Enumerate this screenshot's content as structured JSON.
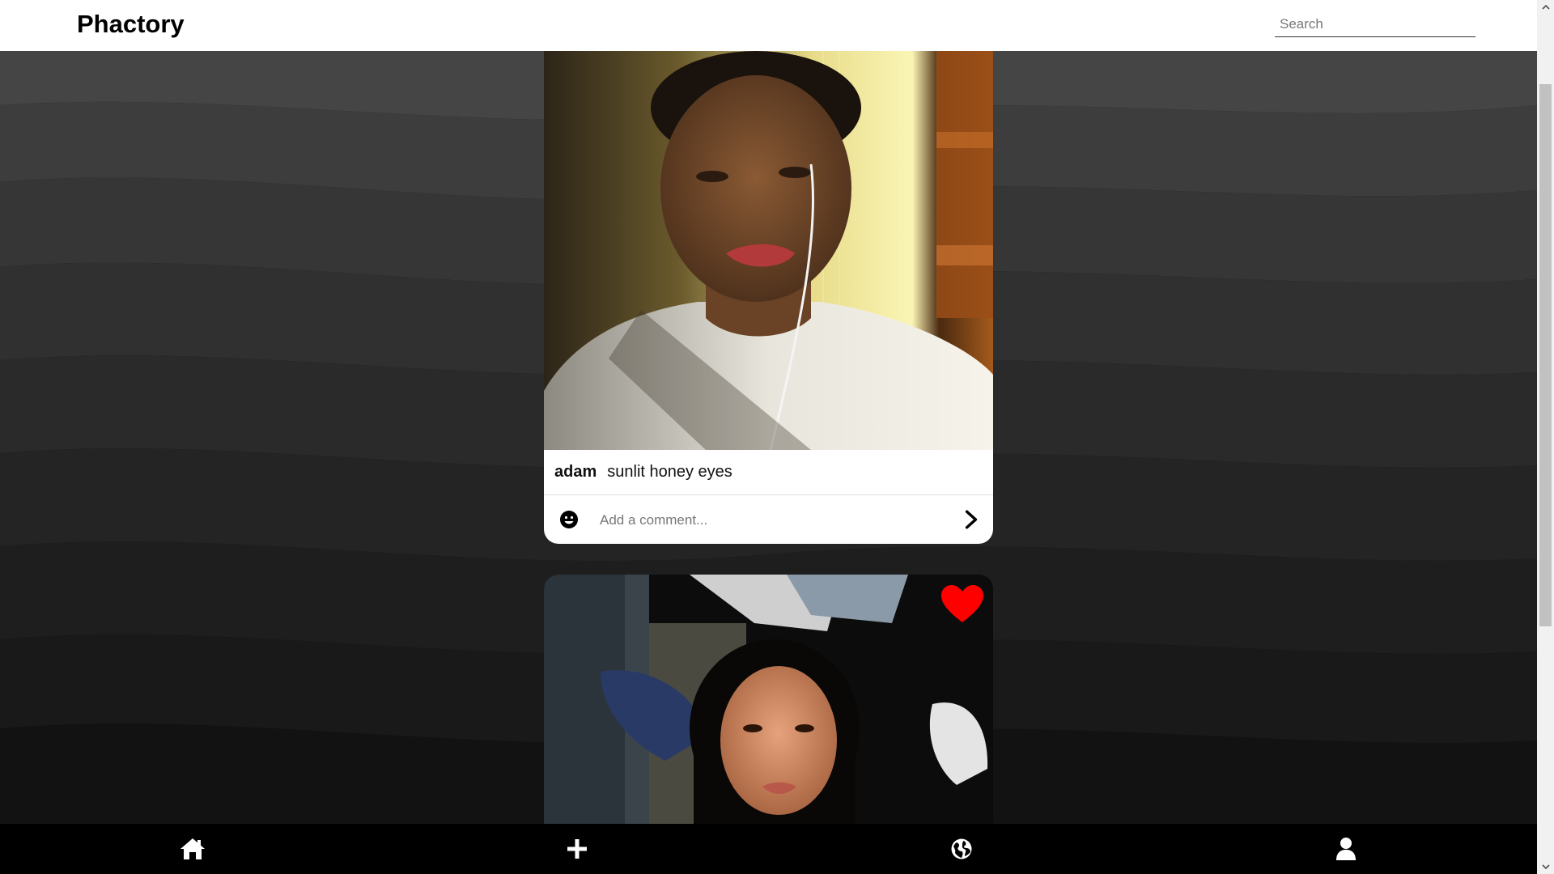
{
  "app": {
    "brand": "Phactory"
  },
  "search": {
    "placeholder": "Search",
    "value": ""
  },
  "feed": {
    "posts": [
      {
        "username": "adam",
        "caption": "sunlit honey eyes",
        "comment_placeholder": "Add a comment...",
        "liked": false
      },
      {
        "username": "",
        "caption": "",
        "liked": true
      }
    ]
  },
  "bottom_nav": {
    "items": [
      {
        "icon": "home-icon"
      },
      {
        "icon": "plus-icon"
      },
      {
        "icon": "globe-icon"
      },
      {
        "icon": "user-icon"
      }
    ]
  },
  "colors": {
    "like": "#ff0000",
    "header_bg": "#ffffff",
    "nav_bg": "#000000"
  }
}
